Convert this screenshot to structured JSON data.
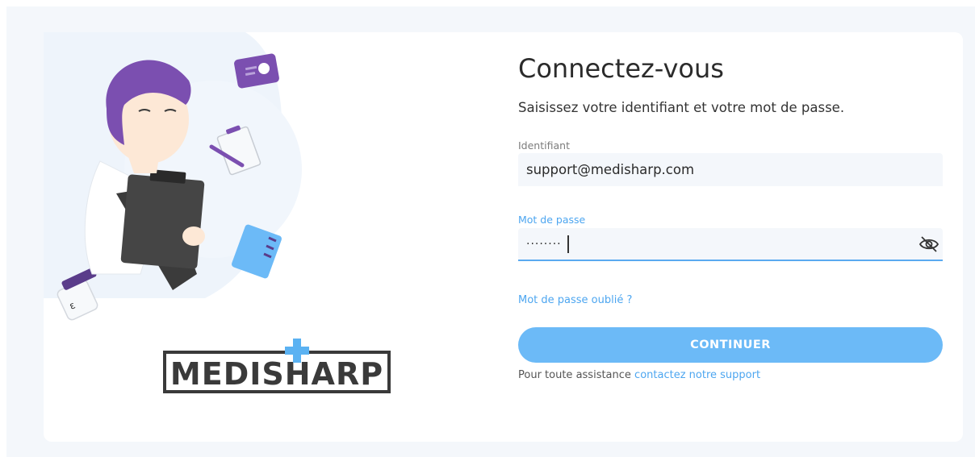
{
  "brand": {
    "name": "MEDISHARP",
    "colors": {
      "accent": "#4da6f0",
      "button": "#6cbaf7",
      "logo_dark": "#3a3a3a",
      "logo_cross": "#5bb2f2"
    }
  },
  "login": {
    "title": "Connectez-vous",
    "subtitle": "Saisissez votre identifiant et votre mot de passe.",
    "username": {
      "label": "Identifiant",
      "value": "support@medisharp.com"
    },
    "password": {
      "label": "Mot de passe",
      "value": "········",
      "icon": "eye-off-icon"
    },
    "forgot_link": "Mot de passe oublié ?",
    "submit_label": "CONTINUER",
    "assist_text": "Pour toute assistance ",
    "assist_link": "contactez notre support"
  }
}
